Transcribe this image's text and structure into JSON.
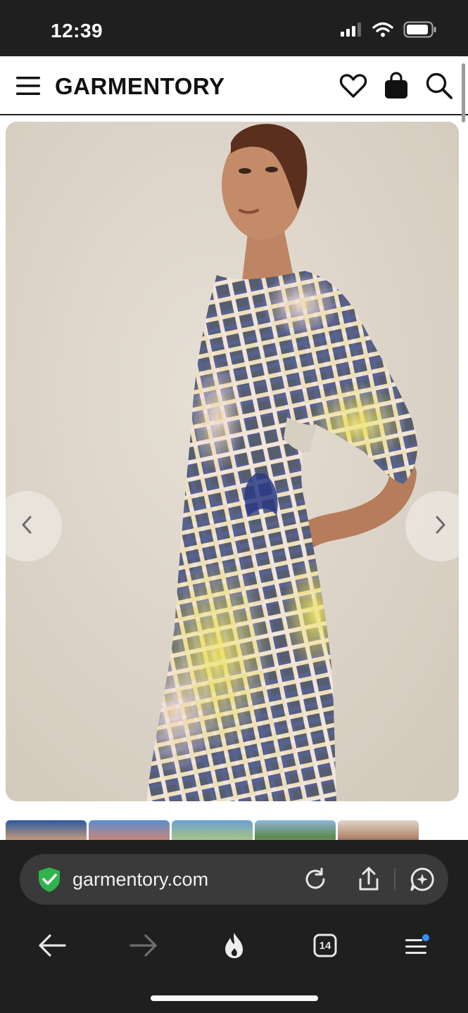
{
  "status_bar": {
    "time": "12:39",
    "icons": [
      "signal-icon",
      "wifi-icon",
      "battery-icon"
    ]
  },
  "header": {
    "brand": "GARMENTORY",
    "icons": [
      "hamburger-menu-icon",
      "heart-icon",
      "shopping-bag-icon",
      "search-icon"
    ]
  },
  "product_gallery": {
    "main_image": "model wearing blue yellow and pink tie-dye grid print dress with puff sleeves and side cutout",
    "prev_icon": "chevron-left-icon",
    "next_icon": "chevron-right-icon"
  },
  "browser": {
    "url": "garmentory.com",
    "tab_count": "14",
    "icons": [
      "shield-check-icon",
      "reload-icon",
      "share-icon",
      "assistant-icon",
      "back-icon",
      "forward-icon",
      "flame-icon",
      "tabs-icon",
      "menu-icon"
    ]
  },
  "colors": {
    "status_bg": "#1f1f1f",
    "browser_bg": "#1f1f1f",
    "urlbar_bg": "#3a3a3a",
    "secure_green": "#2fb34d",
    "photo_bg": "#ddd5ca",
    "dress_navy": "#1f2f72",
    "dress_yellow": "#e5d95a",
    "dress_pink": "#ecd3d4"
  }
}
